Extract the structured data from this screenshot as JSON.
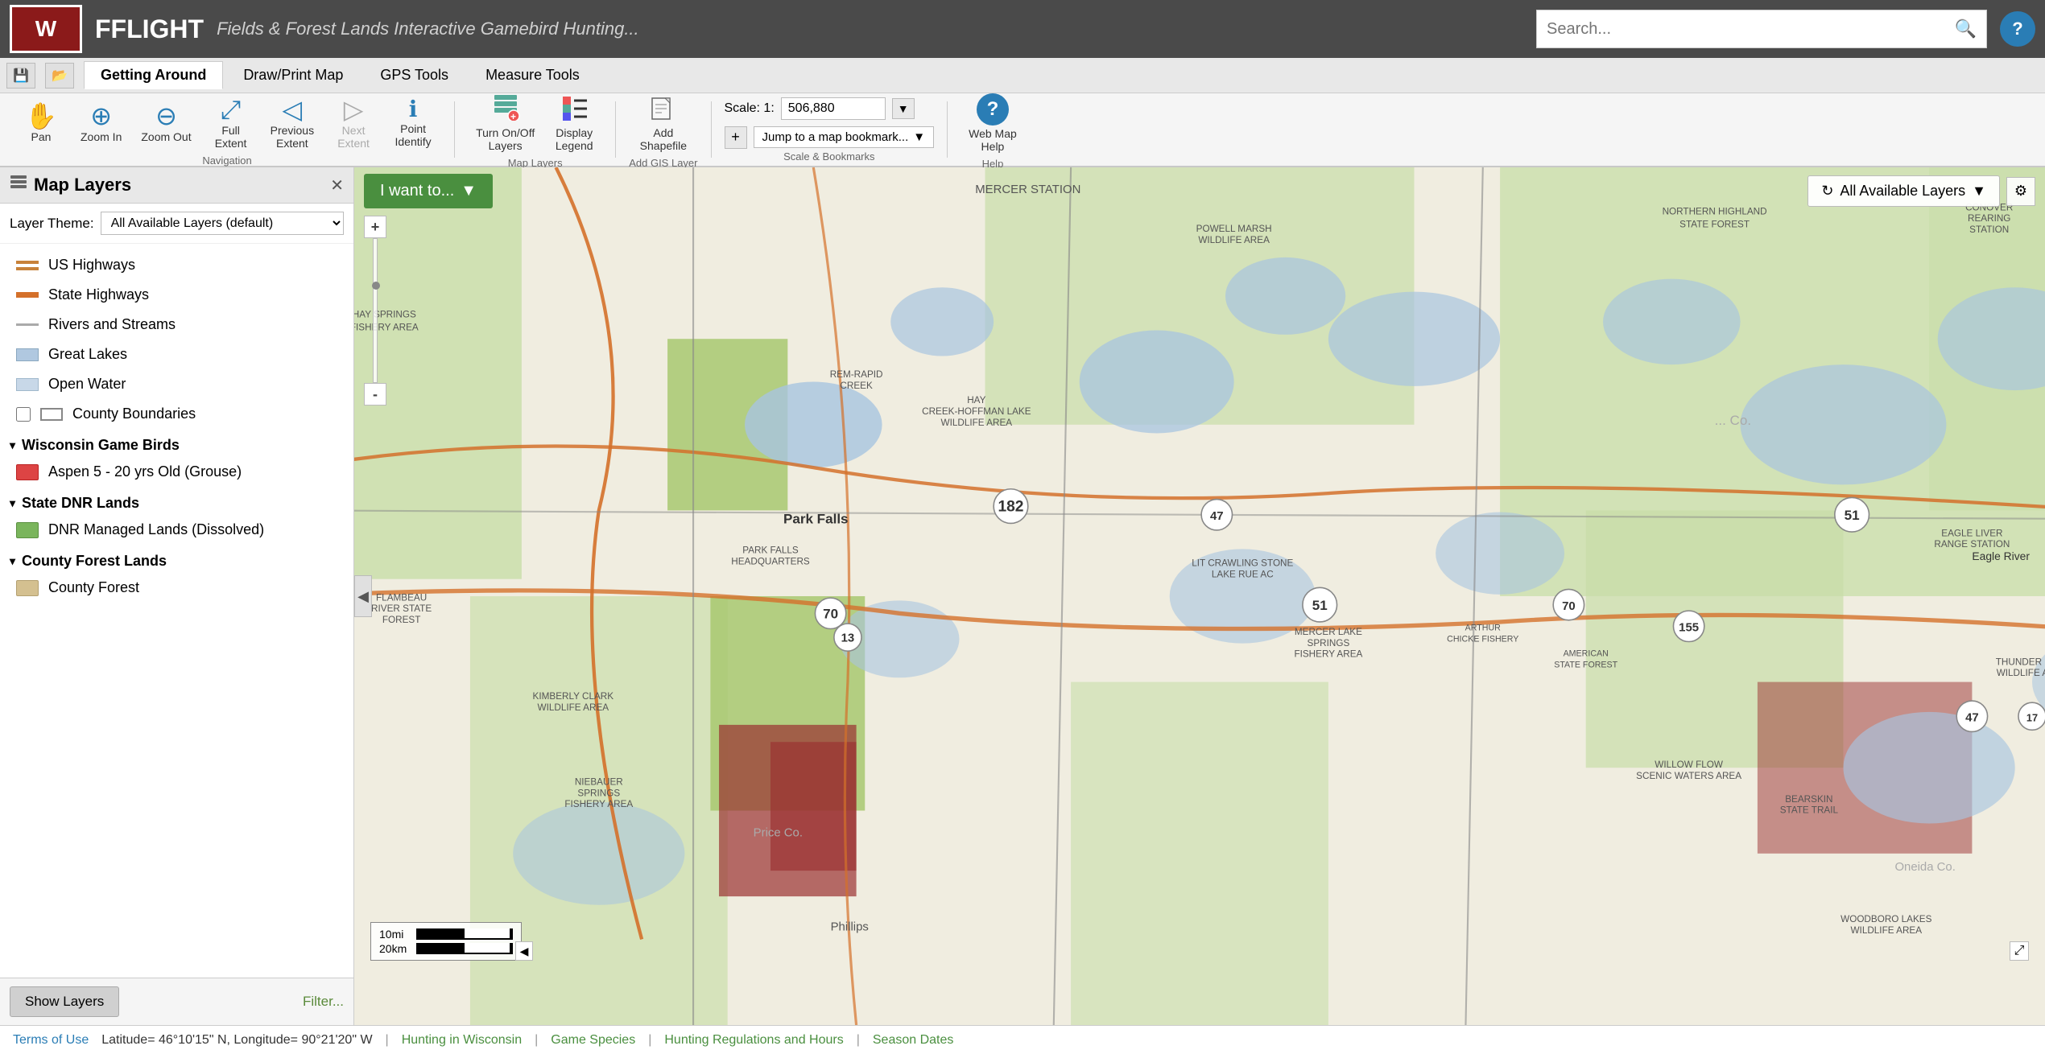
{
  "header": {
    "logo_text": "W",
    "app_title": "FFLIGHT",
    "app_subtitle": "Fields & Forest Lands Interactive Gamebird Hunting...",
    "search_placeholder": "Search...",
    "help_label": "?"
  },
  "tabs": {
    "save_icon": "💾",
    "folder_icon": "📂",
    "items": [
      {
        "id": "getting-around",
        "label": "Getting Around",
        "active": true
      },
      {
        "id": "draw-print-map",
        "label": "Draw/Print Map",
        "active": false
      },
      {
        "id": "gps-tools",
        "label": "GPS Tools",
        "active": false
      },
      {
        "id": "measure-tools",
        "label": "Measure Tools",
        "active": false
      }
    ]
  },
  "toolbar": {
    "navigation": {
      "label": "Navigation",
      "tools": [
        {
          "id": "pan",
          "icon": "✋",
          "label": "Pan"
        },
        {
          "id": "zoom-in",
          "icon": "⊕",
          "label": "Zoom In"
        },
        {
          "id": "zoom-out",
          "icon": "⊖",
          "label": "Zoom Out"
        },
        {
          "id": "full-extent",
          "icon": "⤢",
          "label": "Full Extent"
        },
        {
          "id": "previous-extent",
          "icon": "◁",
          "label": "Previous Extent"
        },
        {
          "id": "next-extent",
          "icon": "▷",
          "label": "Next Extent",
          "disabled": true
        },
        {
          "id": "point-identify",
          "icon": "ℹ",
          "label": "Point Identify"
        }
      ]
    },
    "map_layers": {
      "label": "Map Layers",
      "tools": [
        {
          "id": "turn-on-off",
          "icon": "⊞",
          "label": "Turn On/Off Layers"
        },
        {
          "id": "display-legend",
          "icon": "≡",
          "label": "Display Legend"
        }
      ]
    },
    "add_gis": {
      "label": "Add GIS Layer",
      "tools": [
        {
          "id": "add-shapefile",
          "icon": "📄",
          "label": "Add Shapefile"
        }
      ]
    },
    "scale": {
      "label": "Scale & Bookmarks",
      "scale_prefix": "Scale: 1:",
      "scale_value": "506,880",
      "bookmark_placeholder": "Jump to a map bookmark...",
      "plus_icon": "+"
    },
    "help": {
      "label": "Help",
      "icon": "?",
      "text": "Web Map Help"
    }
  },
  "sidebar": {
    "title": "Map Layers",
    "title_icon": "⊞",
    "close_icon": "✕",
    "layer_theme_label": "Layer Theme:",
    "layer_theme_value": "All Available Layers (default)",
    "layer_theme_options": [
      "All Available Layers (default)"
    ],
    "layers": [
      {
        "id": "us-highways",
        "type": "us-highway",
        "label": "US Highways",
        "checked": true
      },
      {
        "id": "state-highways",
        "type": "state-highway",
        "label": "State Highways",
        "checked": true
      },
      {
        "id": "rivers",
        "type": "rivers",
        "label": "Rivers and Streams",
        "checked": true
      },
      {
        "id": "great-lakes",
        "type": "great-lakes",
        "label": "Great Lakes",
        "checked": true
      },
      {
        "id": "open-water",
        "type": "open-water",
        "label": "Open Water",
        "checked": true
      },
      {
        "id": "county-boundaries",
        "type": "county",
        "label": "County Boundaries",
        "checked": false
      }
    ],
    "sections": [
      {
        "id": "wisconsin-game-birds",
        "label": "Wisconsin Game Birds",
        "collapsed": false,
        "layers": [
          {
            "id": "aspen",
            "type": "aspen",
            "label": "Aspen 5 - 20 yrs Old (Grouse)",
            "checked": true
          }
        ]
      },
      {
        "id": "state-dnr-lands",
        "label": "State DNR Lands",
        "collapsed": false,
        "layers": [
          {
            "id": "dnr-lands",
            "type": "dnr-lands",
            "label": "DNR Managed Lands (Dissolved)",
            "checked": true
          }
        ]
      },
      {
        "id": "county-forest-lands",
        "label": "County Forest Lands",
        "collapsed": false,
        "layers": [
          {
            "id": "county-forest",
            "type": "county-forest",
            "label": "County Forest",
            "checked": true
          }
        ]
      }
    ],
    "show_layers_label": "Show Layers",
    "filter_label": "Filter..."
  },
  "map": {
    "i_want_to_label": "I want to...",
    "all_layers_label": "All Available Layers",
    "collapse_icon": "◀",
    "expand_icon": "◀",
    "zoom_plus": "+",
    "zoom_minus": "-",
    "scale_bar": {
      "mi_label": "10mi",
      "km_label": "20km"
    },
    "place_labels": [
      "MERCER STATION",
      "POWELL MARSH WILDLIFE AREA",
      "NORTHERN HIGHLAND STATE FOREST",
      "CONOVER REARING STATION",
      "HAY SPRINGS FISHERY AREA",
      "REM-RAPID CREEK",
      "HAY CREEK-HOFFMAN LAKE WILDLIFE AREA",
      "Park Falls",
      "PARK FALLS HEADQUARTERS",
      "FLAMBEAU RIVER STATE FOREST",
      "LIT CRAWLING STONE LAKE RUE AC",
      "MERCER LAKE SPRINGS FISHERY AREA",
      "ARTHUR CHICKE FISHERY AREA",
      "AMERICAN STATE FOREST",
      "EAGLE LIVER RANGE STATION Eagle River",
      "THUNDER LAKE WILDLIFE AREA",
      "KIMBERLY CLARK WILDLIFE AREA",
      "NIEBAUER SPRINGS FISHERY AREA",
      "Price Co.",
      "Phillips",
      "WILLOW FLOW SCENIC WATERS AREA",
      "BEARSKIN STATE TRAIL",
      "Oneida Co.",
      "WOODBORO LAKES WILDLIFE AREA"
    ]
  },
  "status_bar": {
    "terms_label": "Terms of Use",
    "coords": "Latitude= 46°10'15\" N, Longitude= 90°21'20\" W",
    "hunting_label": "Hunting in Wisconsin",
    "game_species_label": "Game Species",
    "regulations_label": "Hunting Regulations and Hours",
    "season_dates_label": "Season Dates",
    "separator": "|"
  }
}
